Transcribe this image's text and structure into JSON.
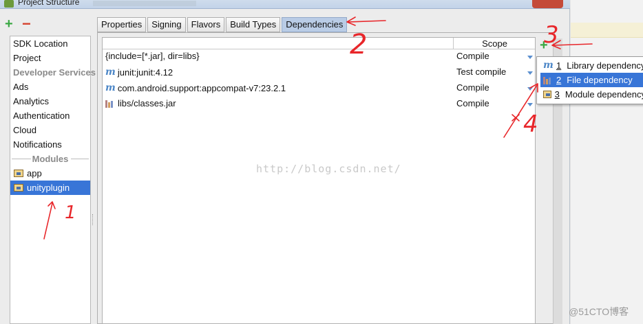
{
  "window": {
    "title": "Project Structure"
  },
  "nav": {
    "add_label": "+",
    "remove_label": "−",
    "items": [
      {
        "label": "SDK Location"
      },
      {
        "label": "Project"
      },
      {
        "label": "Developer Services"
      },
      {
        "label": "Ads"
      },
      {
        "label": "Analytics"
      },
      {
        "label": "Authentication"
      },
      {
        "label": "Cloud"
      },
      {
        "label": "Notifications"
      }
    ],
    "modules_header": "Modules",
    "modules": [
      {
        "label": "app"
      },
      {
        "label": "unityplugin"
      }
    ]
  },
  "tabs": [
    {
      "label": "Properties"
    },
    {
      "label": "Signing"
    },
    {
      "label": "Flavors"
    },
    {
      "label": "Build Types"
    },
    {
      "label": "Dependencies"
    }
  ],
  "table": {
    "scope_header": "Scope",
    "rows": [
      {
        "name": "{include=[*.jar], dir=libs}",
        "scope": "Compile",
        "icon": "none"
      },
      {
        "name": "junit:junit:4.12",
        "scope": "Test compile",
        "icon": "maven-icon"
      },
      {
        "name": "com.android.support:appcompat-v7:23.2.1",
        "scope": "Compile",
        "icon": "maven-icon"
      },
      {
        "name": "libs/classes.jar",
        "scope": "Compile",
        "icon": "jar-icon"
      }
    ]
  },
  "watermark": "http://blog.csdn.net/",
  "add_dependency": "+",
  "menu": {
    "items": [
      {
        "num": "1",
        "label": "Library dependency"
      },
      {
        "num": "2",
        "label": "File dependency"
      },
      {
        "num": "3",
        "label": "Module dependency"
      }
    ]
  },
  "annotations": [
    "1",
    "2",
    "3",
    "4"
  ],
  "corner_watermark": "@51CTO博客",
  "colors": {
    "selection": "#3875d7",
    "active_tab": "#b9cce6",
    "annotation_red": "#e8262a",
    "add_green": "#3aa843"
  }
}
